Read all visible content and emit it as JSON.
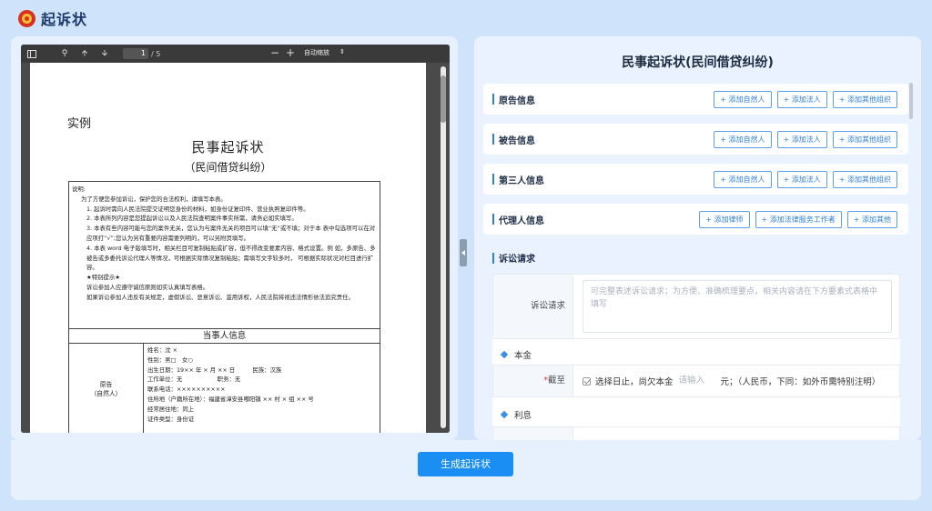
{
  "app": {
    "title": "起诉状"
  },
  "pdf": {
    "page_current": "1",
    "page_total": "/ 5",
    "zoom_label": "自动缩放",
    "zoom_out": "−",
    "zoom_in": "+",
    "doc": {
      "example": "实例",
      "title": "民事起诉状",
      "subtitle": "（民间借贷纠纷）",
      "notes": [
        "说明:",
        "为了方便您参加诉讼，保护您的合法权利，请填写本表。",
        "1. 起诉时需向人民法院提交证明您身份的材料，如身份证复印件、营业执照复印件等。",
        "2. 本表所列内容是您提起诉讼以及人民法院查明案件事实所需，请务必如实填写。",
        "3. 本表有些内容可能与您的案件无关，您认为与案件无关的项目可以填“无”或不填；对于本 表中勾选项可以在对应项打“√”;您认为另有重要内容需要列明的，可以另附页填写。",
        "4. 本表 word 电子版填写时，相关栏目可复制粘贴或扩容，但不得改变要素内容、格式设置。例 如，多原告、多被告或多委托诉讼代理人等情况，可根据实际情况复制粘贴；需填写文字较多时， 可根据实际状况对栏目进行扩容。",
        "★特别提示★",
        "诉讼参加人应遵守诚信原则如实认真填写表格。",
        "如果诉讼参加人违反有关规定，虚假诉讼、恶意诉讼、滥用诉权，人民法院将视违法情形依法追究责任。"
      ],
      "party_header": "当事人信息",
      "party_role_line1": "原告",
      "party_role_line2": "（自然人）",
      "party_info": [
        "姓名：沈 ×",
        "性别：男□　女○",
        "出生日期：19×× 年 × 月 ×× 日　　　民族：汉族",
        "工作单位：无　　　　　　职务：无",
        "联系电话：××××××××××",
        "住所地（户籍所在地）：福建省漳安县嘟阳镇 ×× 村 × 组 ×× 号",
        "经常居住地：同上",
        "证件类型：身份证"
      ]
    }
  },
  "form": {
    "title": "民事起诉状(民间借贷纠纷)",
    "sections": [
      {
        "title": "原告信息",
        "buttons": [
          "+ 添加自然人",
          "+ 添加法人",
          "+ 添加其他组织"
        ]
      },
      {
        "title": "被告信息",
        "buttons": [
          "+ 添加自然人",
          "+ 添加法人",
          "+ 添加其他组织"
        ]
      },
      {
        "title": "第三人信息",
        "buttons": [
          "+ 添加自然人",
          "+ 添加法人",
          "+ 添加其他组织"
        ]
      },
      {
        "title": "代理人信息",
        "buttons": [
          "+ 添加律师",
          "+ 添加法律服务工作者",
          "+ 添加其他"
        ]
      }
    ],
    "claims": {
      "title": "诉讼请求",
      "label": "诉讼请求",
      "placeholder": "可完整表述诉讼请求；为方便、准确梳理要点，相关内容请在下方要素式表格中填写",
      "principal_title": "本金",
      "date_label_req": "*",
      "date_label": "截至",
      "select_date": "选择日止，尚欠本金",
      "amount_placeholder": "请输入",
      "currency_note": "元；（人民币，下同：如外币需特别注明）",
      "interest_title": "利息"
    }
  },
  "footer": {
    "generate_label": "生成起诉状"
  },
  "colors": {
    "accent": "#1a8ef2",
    "background": "#cfe3fb",
    "required": "#e23c39"
  }
}
